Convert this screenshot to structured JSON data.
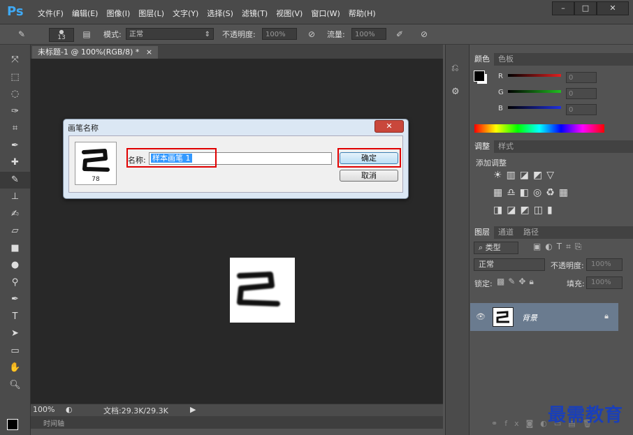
{
  "app": {
    "logo": "Ps",
    "menu": [
      "文件(F)",
      "编辑(E)",
      "图像(I)",
      "图层(L)",
      "文字(Y)",
      "选择(S)",
      "滤镜(T)",
      "视图(V)",
      "窗口(W)",
      "帮助(H)"
    ],
    "window_buttons": {
      "minimize": "–",
      "maximize": "□",
      "close": "✕"
    }
  },
  "options_bar": {
    "brush_size": "13",
    "mode_label": "模式:",
    "mode_value": "正常",
    "opacity_label": "不透明度:",
    "opacity_value": "100%",
    "flow_label": "流量:",
    "flow_value": "100%"
  },
  "document": {
    "tab_title": "未标题-1 @ 100%(RGB/8) *",
    "tab_close": "×",
    "zoom": "100%",
    "doc_info": "文档:29.3K/29.3K",
    "timeline_label": "时间轴"
  },
  "tools": [
    "move-icon",
    "marquee-icon",
    "lasso-icon",
    "quick-select-icon",
    "crop-icon",
    "eyedropper-icon",
    "healing-icon",
    "brush-icon",
    "stamp-icon",
    "history-brush-icon",
    "eraser-icon",
    "gradient-icon",
    "blur-icon",
    "dodge-icon",
    "pen-icon",
    "type-icon",
    "path-select-icon",
    "shape-icon",
    "hand-icon",
    "zoom-icon"
  ],
  "color_panel": {
    "tabs": [
      "颜色",
      "色板"
    ],
    "channels": [
      {
        "label": "R",
        "value": "0",
        "color": "#e02020"
      },
      {
        "label": "G",
        "value": "0",
        "color": "#20c020"
      },
      {
        "label": "B",
        "value": "0",
        "color": "#2030e0"
      }
    ]
  },
  "adjust_panel": {
    "tabs": [
      "调整",
      "样式"
    ],
    "title": "添加调整"
  },
  "layers_panel": {
    "tabs": [
      "图层",
      "通道",
      "路径"
    ],
    "filter_kind": "类型",
    "blend_mode": "正常",
    "opacity_label": "不透明度:",
    "opacity_value": "100%",
    "lock_label": "锁定:",
    "fill_label": "填充:",
    "fill_value": "100%",
    "layers": [
      {
        "name": "背景"
      }
    ]
  },
  "dialog": {
    "title": "画笔名称",
    "close": "✕",
    "brush_size": "78",
    "name_label": "名称:",
    "name_value": "样本画笔 1",
    "ok_label": "确定",
    "cancel_label": "取消"
  },
  "watermark": "最需教育"
}
